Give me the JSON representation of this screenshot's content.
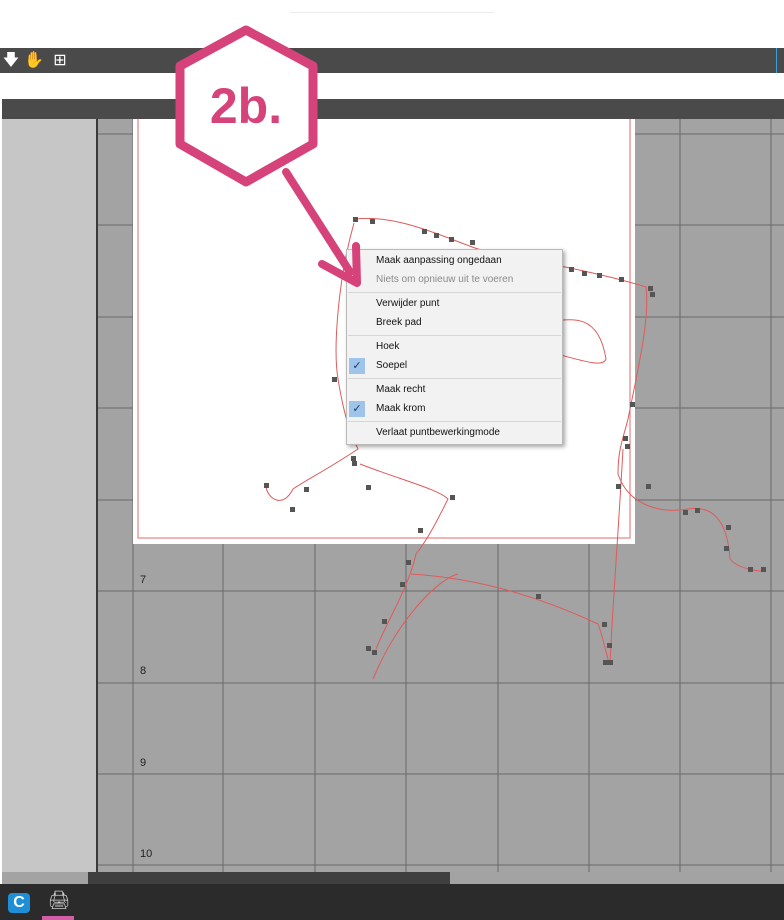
{
  "toolbar": {
    "tools": [
      {
        "name": "move-down-icon",
        "glyph": "🡇"
      },
      {
        "name": "hand-pan-icon",
        "glyph": "✋"
      },
      {
        "name": "fit-page-icon",
        "glyph": "⊞"
      }
    ]
  },
  "ruler": {
    "labels": [
      "7",
      "8",
      "9",
      "10"
    ]
  },
  "badge": {
    "label": "2b.",
    "color": "#d6427a"
  },
  "context_menu": {
    "items": [
      {
        "label": "Maak aanpassing ongedaan",
        "enabled": true,
        "checked": false
      },
      {
        "label": "Niets om opnieuw uit te voeren",
        "enabled": false,
        "checked": false
      },
      {
        "label": "Verwijder punt",
        "enabled": true,
        "checked": false
      },
      {
        "label": "Breek pad",
        "enabled": true,
        "checked": false
      },
      {
        "label": "Hoek",
        "enabled": true,
        "checked": false
      },
      {
        "label": "Soepel",
        "enabled": true,
        "checked": true
      },
      {
        "label": "Maak recht",
        "enabled": true,
        "checked": false
      },
      {
        "label": "Maak krom",
        "enabled": true,
        "checked": true
      },
      {
        "label": "Verlaat puntbewerkingmode",
        "enabled": true,
        "checked": false
      }
    ]
  },
  "taskbar": {
    "apps": [
      {
        "name": "c-app-icon",
        "glyph": "C"
      },
      {
        "name": "printer-app-icon",
        "glyph": "🖨"
      }
    ]
  },
  "colors": {
    "cut_line": "#e05a5a",
    "node": "#555555",
    "accent": "#d6427a"
  }
}
